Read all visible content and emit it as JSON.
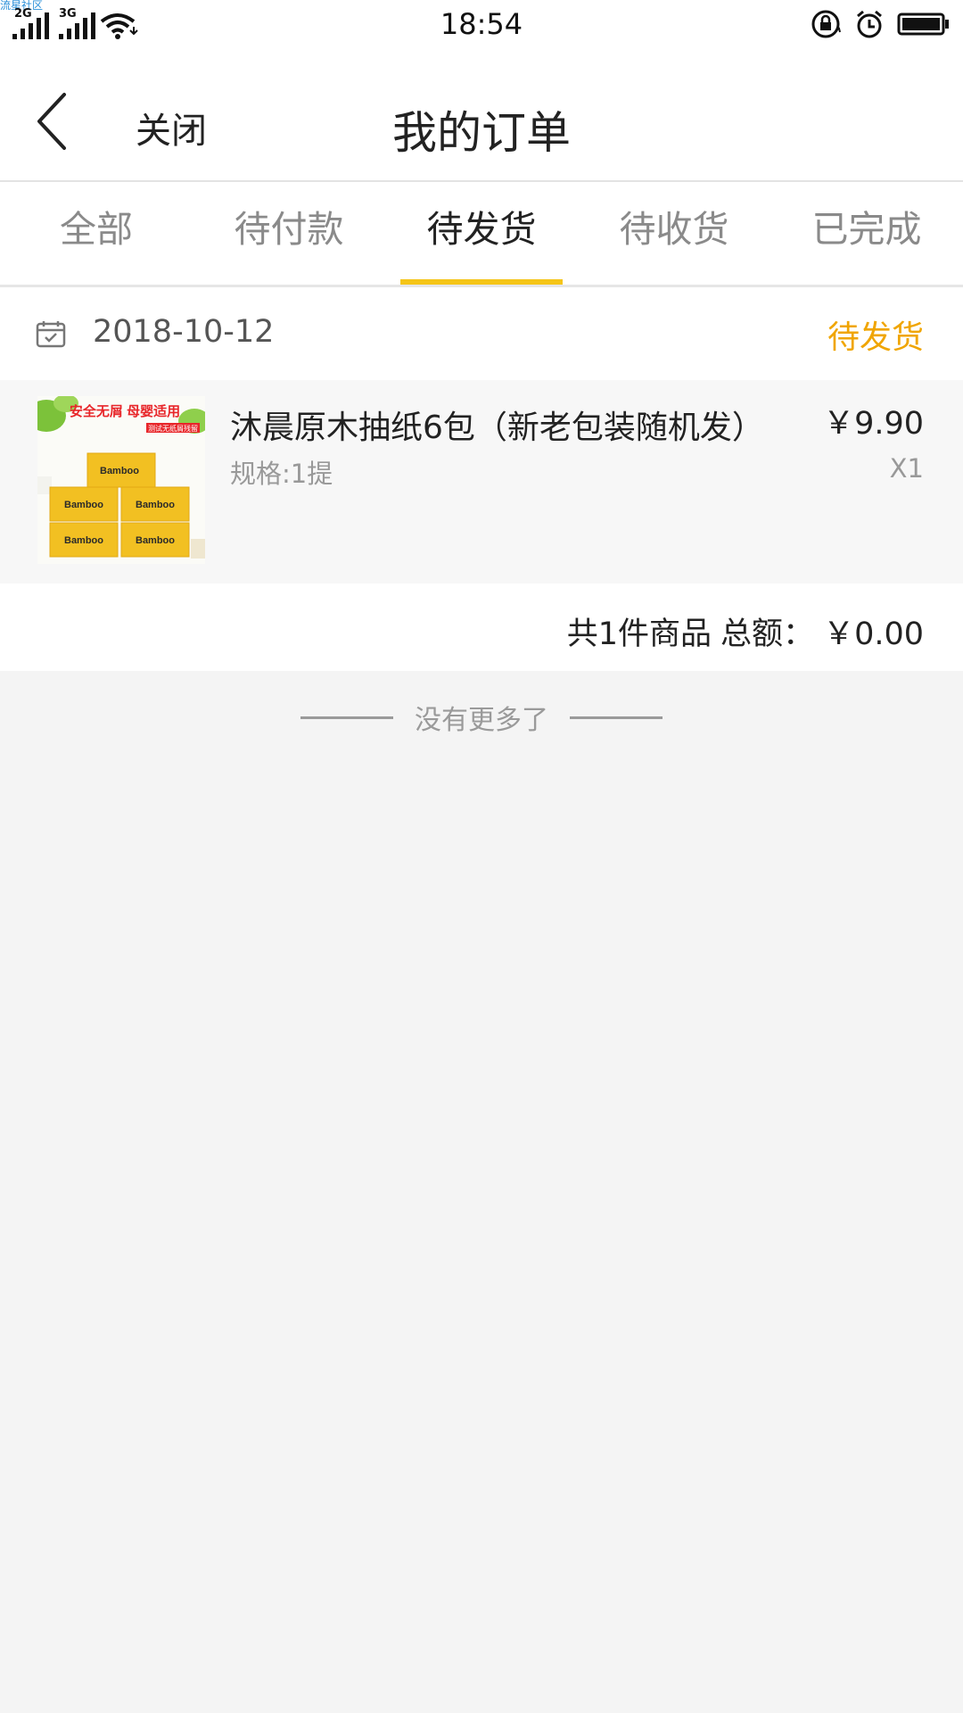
{
  "status_bar": {
    "watermark": "流星社区",
    "sim1": "2G",
    "sim2": "3G",
    "time": "18:54",
    "icons": [
      "wifi-icon",
      "rotation-lock-icon",
      "alarm-icon",
      "battery-icon"
    ]
  },
  "header": {
    "close_label": "关闭",
    "title": "我的订单"
  },
  "tabs": [
    {
      "label": "全部",
      "active": false
    },
    {
      "label": "待付款",
      "active": false
    },
    {
      "label": "待发货",
      "active": true
    },
    {
      "label": "待收货",
      "active": false
    },
    {
      "label": "已完成",
      "active": false
    }
  ],
  "order": {
    "date": "2018-10-12",
    "status": "待发货",
    "item": {
      "name": "沐晨原木抽纸6包（新老包装随机发）",
      "price": "￥9.90",
      "spec": "规格:1提",
      "qty": "X1",
      "image": {
        "banner": "安全无屑 母婴适用",
        "subbanner": "测试无纸屑残留",
        "brand": "Bamboo"
      }
    },
    "summary": {
      "count_text": "共1件商品",
      "total_label": "总额：",
      "total_value": "￥0.00"
    }
  },
  "footer": {
    "no_more": "没有更多了"
  },
  "colors": {
    "accent": "#f5c518",
    "status": "#f0a500",
    "background": "#f4f4f4"
  }
}
